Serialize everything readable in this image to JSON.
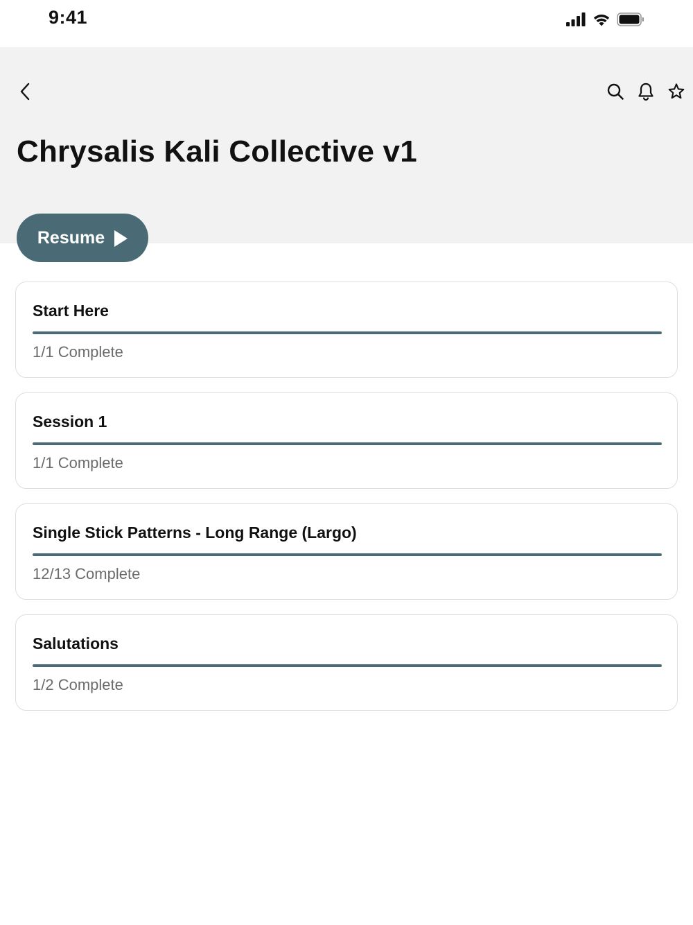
{
  "status_bar": {
    "time": "9:41",
    "icons": [
      "cellular-signal-icon",
      "wifi-icon",
      "battery-icon"
    ]
  },
  "header": {
    "title": "Chrysalis Kali Collective v1",
    "icons": [
      "back-chevron-icon",
      "search-icon",
      "bell-icon",
      "star-icon"
    ]
  },
  "resume_button": {
    "label": "Resume",
    "icon": "play-icon"
  },
  "colors": {
    "accent": "#4a6b76",
    "header_bg": "#f2f2f2",
    "card_border": "#dedede",
    "muted_text": "#6b6b6b"
  },
  "modules": [
    {
      "title": "Start Here",
      "status": "1/1 Complete",
      "progress": 1.0
    },
    {
      "title": "Session 1",
      "status": "1/1 Complete",
      "progress": 1.0
    },
    {
      "title": "Single Stick Patterns - Long Range (Largo)",
      "status": "12/13 Complete",
      "progress": 1.0
    },
    {
      "title": "Salutations",
      "status": "1/2 Complete",
      "progress": 1.0
    }
  ]
}
